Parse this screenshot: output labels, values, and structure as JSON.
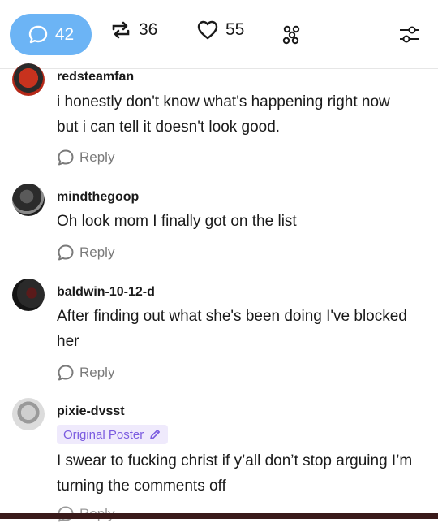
{
  "toolbar": {
    "comments_count": "42",
    "reblogs_count": "36",
    "likes_count": "55",
    "accent_color": "#6cb4f5"
  },
  "comments": [
    {
      "username": "redsteamfan",
      "text": "i honestly don't know what's happening right now but i can tell it doesn't look good.",
      "reply_label": "Reply"
    },
    {
      "username": "mindthegoop",
      "text": "Oh look mom I finally got on the list",
      "reply_label": "Reply"
    },
    {
      "username": "baldwin-10-12-d",
      "text": "After finding out what she's been doing I've blocked her",
      "reply_label": "Reply"
    },
    {
      "username": "pixie-dvsst",
      "badge": "Original Poster",
      "text": "I swear to fucking christ if y’all don’t stop arguing I’m turning the comments off",
      "reply_label": "Reply"
    }
  ],
  "icons": [
    "comment-bubble-icon",
    "reblog-icon",
    "heart-icon",
    "activity-icon",
    "filter-sliders-icon",
    "edit-pencil-icon"
  ]
}
